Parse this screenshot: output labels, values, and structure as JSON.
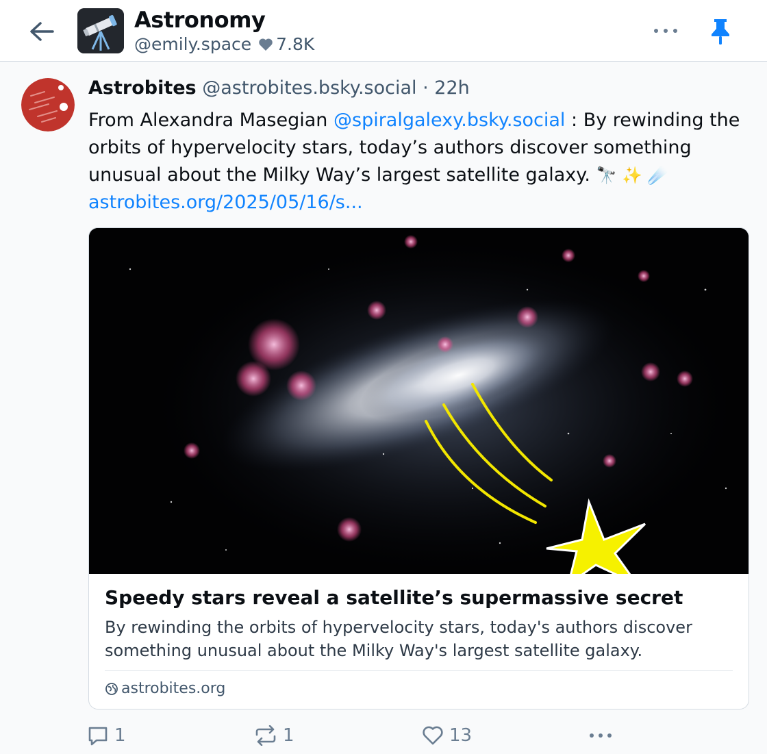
{
  "header": {
    "feed_title": "Astronomy",
    "feed_handle": "@emily.space",
    "likes": "7.8K",
    "icons": {
      "back": "arrow-left-icon",
      "more": "ellipsis-icon",
      "pin": "pin-icon",
      "heart": "heart-icon"
    },
    "accent": "#1083fe"
  },
  "post": {
    "author_name": "Astrobites",
    "author_handle": "@astrobites.bsky.social",
    "separator": " · ",
    "time": "22h",
    "text_prefix": "From Alexandra Masegian ",
    "mention": "@spiralgalexy.bsky.social",
    "text_suffix": " : By rewinding the orbits of hypervelocity stars, today’s authors discover something unusual about the Milky Way’s largest satellite galaxy. ",
    "emojis": "🔭 ✨ ☄️",
    "link": "astrobites.org/2025/05/16/s..."
  },
  "card": {
    "title": "Speedy stars reveal a satellite’s supermassive secret",
    "description": "By rewinding the orbits of hypervelocity stars, today's authors discover something unusual about the Milky Way's largest satellite galaxy.",
    "domain": "astrobites.org"
  },
  "actions": {
    "replies": "1",
    "reposts": "1",
    "likes": "13"
  }
}
